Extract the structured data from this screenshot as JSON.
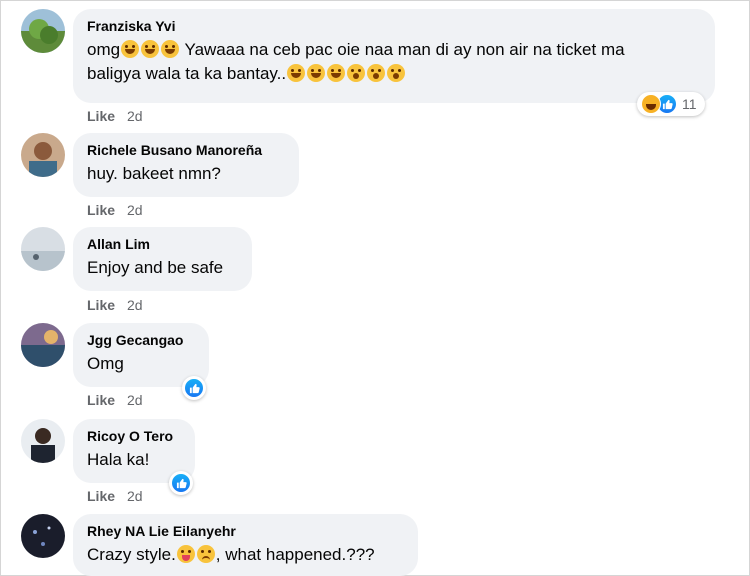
{
  "comments": [
    {
      "author": "Franziska Yvi",
      "text_line1": "omg",
      "text_line1_rest": " Yawaaa na ceb pac oie naa man di ay non air na ticket ma",
      "text_line2": "baligya wala ta ka bantay..",
      "like_label": "Like",
      "time": "2d",
      "reactions": [
        "haha-icon",
        "like-icon"
      ],
      "reaction_count": "11"
    },
    {
      "author": "Richele Busano Manoreña",
      "text": "huy. bakeet nmn?",
      "like_label": "Like",
      "time": "2d"
    },
    {
      "author": "Allan Lim",
      "text": "Enjoy and be safe",
      "like_label": "Like",
      "time": "2d"
    },
    {
      "author": "Jgg Gecangao",
      "text": "Omg",
      "like_label": "Like",
      "time": "2d",
      "reactions": [
        "like-icon"
      ]
    },
    {
      "author": "Ricoy O Tero",
      "text": "Hala ka!",
      "like_label": "Like",
      "time": "2d",
      "reactions": [
        "like-icon"
      ]
    },
    {
      "author": "Rhey NA Lie Eilanyehr",
      "text_prefix": "Crazy style.",
      "text_suffix": ", what happened.???"
    }
  ],
  "colors": {
    "bubble": "#f0f2f5",
    "meta_text": "#65676b",
    "like_blue": "#1877f2",
    "haha_yellow": "#f7b125"
  }
}
